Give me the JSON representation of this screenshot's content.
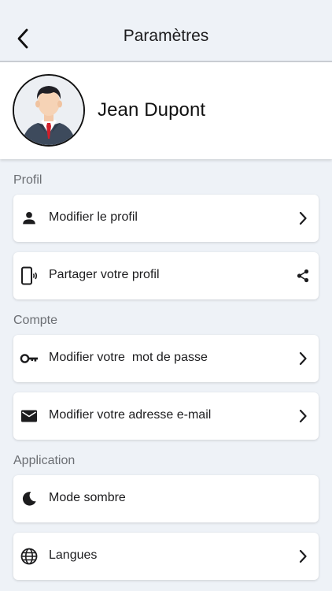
{
  "header": {
    "title": "Paramètres",
    "back_icon": "chevron-left-icon"
  },
  "profile": {
    "name": "Jean Dupont",
    "avatar": "user-avatar-illustration"
  },
  "sections": [
    {
      "label": "Profil",
      "items": [
        {
          "label": "Modifier le profil",
          "icon": "person-icon",
          "trailing": "chevron-right-icon"
        },
        {
          "label": "Partager votre profil",
          "icon": "phone-share-icon",
          "trailing": "share-icon"
        }
      ]
    },
    {
      "label": "Compte",
      "items": [
        {
          "label": "Modifier votre  mot de passe",
          "icon": "key-icon",
          "trailing": "chevron-right-icon"
        },
        {
          "label": "Modifier votre adresse e-mail",
          "icon": "mail-icon",
          "trailing": "chevron-right-icon"
        }
      ]
    },
    {
      "label": "Application",
      "items": [
        {
          "label": "Mode sombre",
          "icon": "moon-icon",
          "trailing": ""
        },
        {
          "label": "Langues",
          "icon": "globe-icon",
          "trailing": "chevron-right-icon"
        }
      ]
    }
  ]
}
